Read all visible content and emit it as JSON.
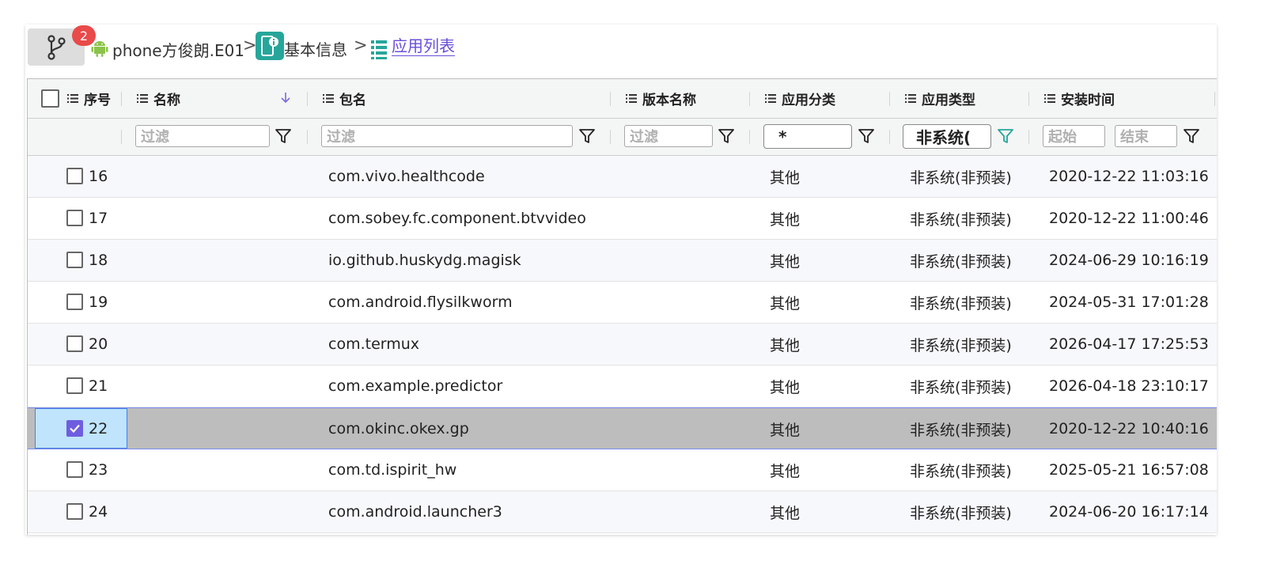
{
  "breadcrumb": {
    "badge_count": "2",
    "device": "phone方俊朗.E01",
    "separator": ">",
    "info": "基本信息",
    "current": "应用列表"
  },
  "columns": {
    "index": "序号",
    "name": "名称",
    "package": "包名",
    "version": "版本名称",
    "category": "应用分类",
    "type": "应用类型",
    "install_time": "安装时间"
  },
  "filters": {
    "name_placeholder": "过滤",
    "package_placeholder": "过滤",
    "version_placeholder": "过滤",
    "category_value": "*",
    "type_value": "非系统(",
    "start_placeholder": "起始",
    "end_placeholder": "结束"
  },
  "rows": [
    {
      "index": "16",
      "package": "com.vivo.healthcode",
      "category": "其他",
      "type": "非系统(非预装)",
      "time": "2020-12-22 11:03:16",
      "checked": false
    },
    {
      "index": "17",
      "package": "com.sobey.fc.component.btvvideo",
      "category": "其他",
      "type": "非系统(非预装)",
      "time": "2020-12-22 11:00:46",
      "checked": false
    },
    {
      "index": "18",
      "package": "io.github.huskydg.magisk",
      "category": "其他",
      "type": "非系统(非预装)",
      "time": "2024-06-29 10:16:19",
      "checked": false
    },
    {
      "index": "19",
      "package": "com.android.flysilkworm",
      "category": "其他",
      "type": "非系统(非预装)",
      "time": "2024-05-31 17:01:28",
      "checked": false
    },
    {
      "index": "20",
      "package": "com.termux",
      "category": "其他",
      "type": "非系统(非预装)",
      "time": "2026-04-17 17:25:53",
      "checked": false
    },
    {
      "index": "21",
      "package": "com.example.predictor",
      "category": "其他",
      "type": "非系统(非预装)",
      "time": "2026-04-18 23:10:17",
      "checked": false
    },
    {
      "index": "22",
      "package": "com.okinc.okex.gp",
      "category": "其他",
      "type": "非系统(非预装)",
      "time": "2020-12-22 10:40:16",
      "checked": true
    },
    {
      "index": "23",
      "package": "com.td.ispirit_hw",
      "category": "其他",
      "type": "非系统(非预装)",
      "time": "2025-05-21 16:57:08",
      "checked": false
    },
    {
      "index": "24",
      "package": "com.android.launcher3",
      "category": "其他",
      "type": "非系统(非预装)",
      "time": "2024-06-20 16:17:14",
      "checked": false
    }
  ],
  "colors": {
    "accent": "#6f5de0",
    "link": "#6a4fd8",
    "badge": "#e94a4a",
    "info_icon": "#26a69a",
    "android_icon": "#8bc34a",
    "active_filter": "#26a69a",
    "selected_row": "#bdbdbd"
  }
}
